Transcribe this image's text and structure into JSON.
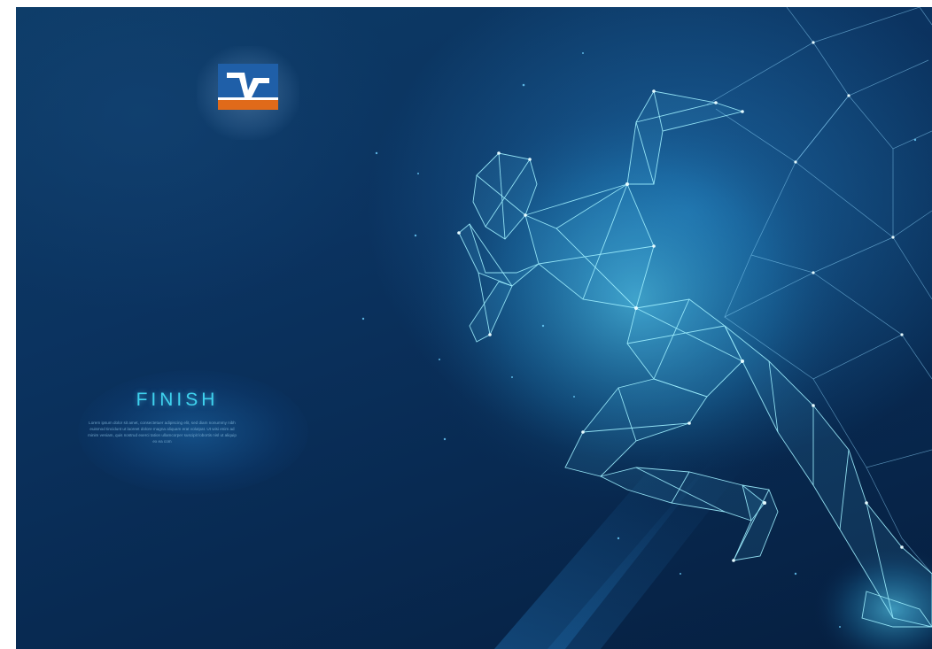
{
  "poster": {
    "title": "FINISH",
    "body": "Lorem ipsum dolor sit amet, consectetuer adipiscing elit, sed diam nonummy nibh euismod tincidunt ut laoreet dolore magna aliquam erat volutpat. Ut wisi enim ad minim veniam, quis nostrud exerci tation ullamcorper suscipit lobortis nisl ut aliquip ex ea com",
    "logo": {
      "name": "volksbank-logo",
      "colors": {
        "blue": "#1f5fa8",
        "orange": "#e06a1a",
        "white": "#ffffff"
      }
    },
    "illustration": "runner-figure-icon",
    "colors": {
      "background_dark": "#061f40",
      "background_mid": "#0d3b66",
      "accent_cyan": "#3fd2ee",
      "wireframe": "#7fe6ff"
    }
  }
}
